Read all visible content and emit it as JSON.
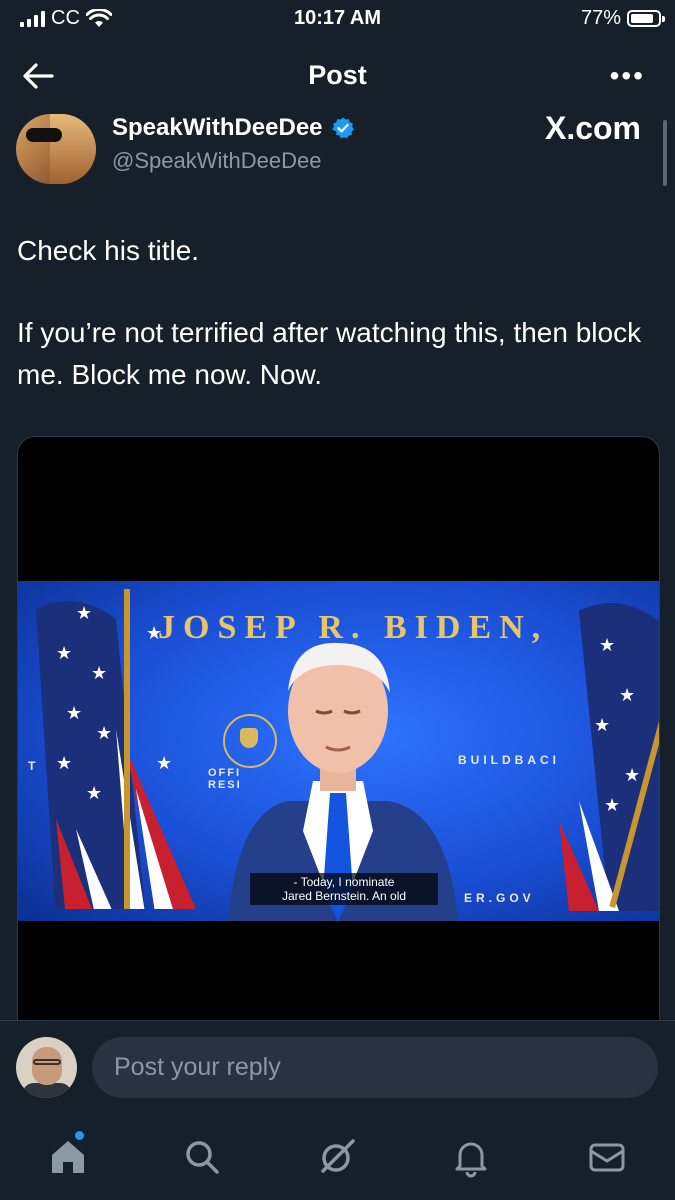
{
  "status_bar": {
    "carrier": "CC",
    "time": "10:17 AM",
    "battery_percent": "77%"
  },
  "header": {
    "title": "Post",
    "more_label": "•••"
  },
  "author": {
    "display_name": "SpeakWithDeeDee",
    "handle": "@SpeakWithDeeDee",
    "verified": true
  },
  "watermark": "X.com",
  "tweet": {
    "paragraphs": [
      "Check his title.",
      "If you’re not terrified after watching this, then block me. Block me now. Now."
    ]
  },
  "media": {
    "nameplate": "JOSEPH R. BIDEN",
    "nameplate_visible": "JOSEP  R. BIDEN,",
    "backdrop_text_left": "OFFI\nRESI",
    "backdrop_text_right": "BUILDBACI",
    "backdrop_text_bottom": "ER.GOV",
    "backdrop_letter": "T",
    "caption_lines": [
      "- Today, I nominate",
      "Jared Bernstein. An old"
    ]
  },
  "reply": {
    "placeholder": "Post your reply"
  },
  "nav": {
    "items": [
      "home-icon",
      "search-icon",
      "grok-icon",
      "notifications-icon",
      "messages-icon"
    ],
    "home_has_badge": true
  },
  "colors": {
    "background": "#15202b",
    "accent": "#1d9bf0",
    "muted_text": "#8b98a5",
    "input_bg": "#273340"
  }
}
